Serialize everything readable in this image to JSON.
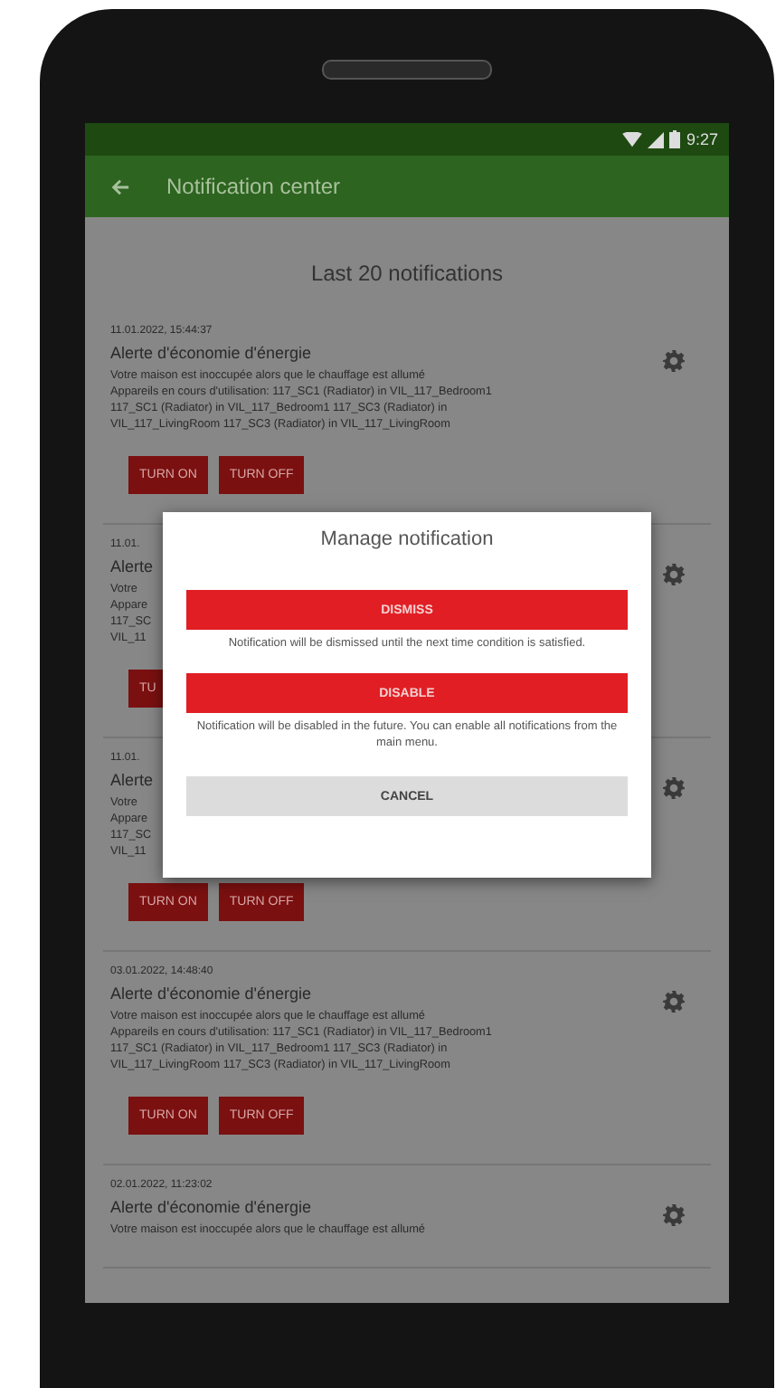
{
  "status_bar": {
    "time": "9:27"
  },
  "app_bar": {
    "title": "Notification center"
  },
  "heading": "Last 20 notifications",
  "notifications": [
    {
      "date": "11.01.2022, 15:44:37",
      "title": "Alerte d'économie d'énergie",
      "body_lines": [
        "Votre maison est inoccupée alors que le chauffage est allumé",
        "Appareils en cours d'utilisation: 117_SC1 (Radiator) in VIL_117_Bedroom1",
        "117_SC1 (Radiator) in VIL_117_Bedroom1 117_SC3 (Radiator) in",
        "VIL_117_LivingRoom 117_SC3 (Radiator) in VIL_117_LivingRoom"
      ],
      "buttons": [
        "TURN ON",
        "TURN OFF"
      ]
    },
    {
      "date": "11.01.",
      "title": "Alerte",
      "body_lines": [
        "Votre",
        "Appare",
        "117_SC",
        "VIL_11"
      ],
      "buttons": [
        "TU"
      ]
    },
    {
      "date": "11.01.",
      "title": "Alerte",
      "body_lines": [
        "Votre",
        "Appare",
        "117_SC",
        "VIL_11"
      ],
      "buttons": [
        "TURN ON",
        "TURN OFF"
      ]
    },
    {
      "date": "03.01.2022, 14:48:40",
      "title": "Alerte d'économie d'énergie",
      "body_lines": [
        "Votre maison est inoccupée alors que le chauffage est allumé",
        "Appareils en cours d'utilisation: 117_SC1 (Radiator) in VIL_117_Bedroom1",
        "117_SC1 (Radiator) in VIL_117_Bedroom1 117_SC3 (Radiator) in",
        "VIL_117_LivingRoom 117_SC3 (Radiator) in VIL_117_LivingRoom"
      ],
      "buttons": [
        "TURN ON",
        "TURN OFF"
      ]
    },
    {
      "date": "02.01.2022, 11:23:02",
      "title": "Alerte d'économie d'énergie",
      "body_lines": [
        "Votre maison est inoccupée alors que le chauffage est allumé"
      ]
    }
  ],
  "dialog": {
    "title": "Manage notification",
    "actions": [
      {
        "kind": "primary",
        "label": "DISMISS",
        "description": "Notification will be dismissed until the next time condition is satisfied."
      },
      {
        "kind": "primary",
        "label": "DISABLE",
        "description": "Notification will be disabled in the future. You can enable all notifications from the main menu."
      },
      {
        "kind": "secondary",
        "label": "CANCEL"
      }
    ]
  }
}
